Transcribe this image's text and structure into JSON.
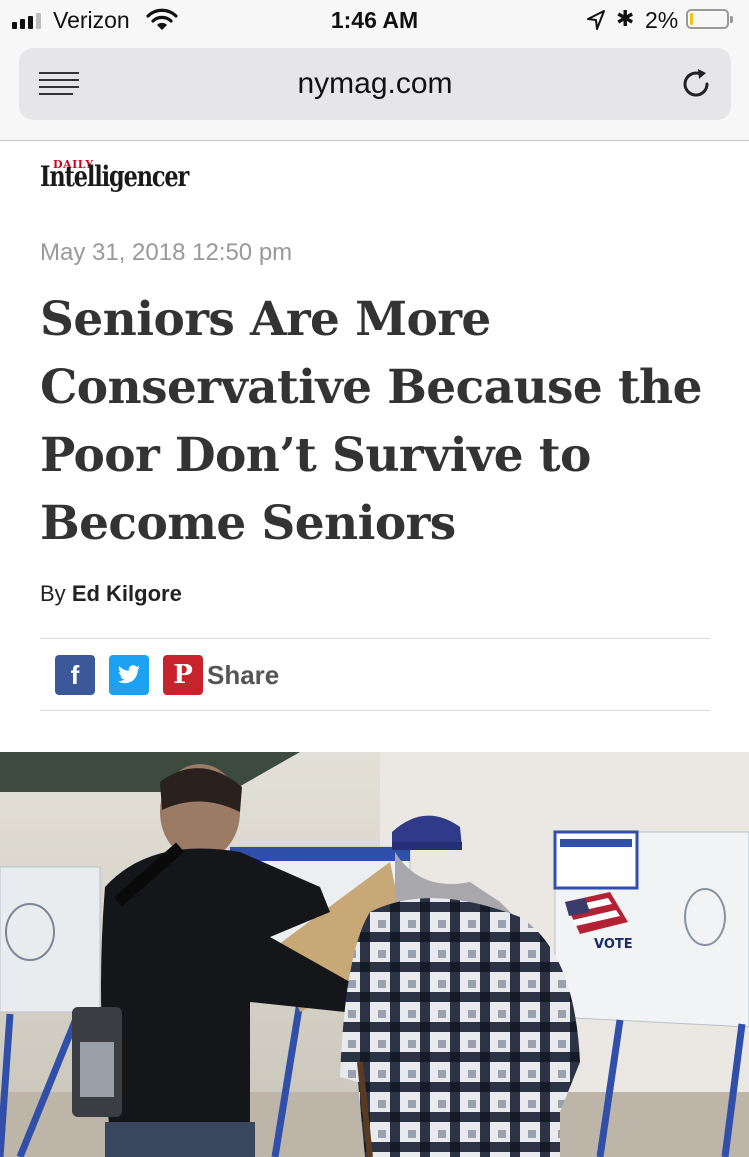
{
  "status_bar": {
    "carrier": "Verizon",
    "time": "1:46 AM",
    "battery_percent": "2%",
    "battery_level": 0.02,
    "icons": [
      "signal-bars-icon",
      "wifi-icon",
      "location-arrow-icon",
      "bluetooth-icon",
      "battery-icon"
    ]
  },
  "browser": {
    "domain": "nymag.com",
    "icons": [
      "reader-menu-icon",
      "reload-icon"
    ]
  },
  "article": {
    "logo_small": "DAILY",
    "logo_main": "Intelligencer",
    "date": "May 31, 2018 12:50 pm",
    "headline": "Seniors Are More Conservative Because the Poor Don’t Survive to Become Seniors",
    "byline_prefix": "By",
    "author": "Ed Kilgore",
    "share": {
      "facebook_glyph": "f",
      "pinterest_glyph": "P",
      "label": "Share"
    },
    "photo": {
      "sign_text": "VOTE"
    }
  },
  "colors": {
    "facebook": "#3b5998",
    "twitter": "#1da1f2",
    "pinterest": "#c8232c",
    "logo_accent": "#d0021b",
    "battery_low": "#f1c40f"
  }
}
